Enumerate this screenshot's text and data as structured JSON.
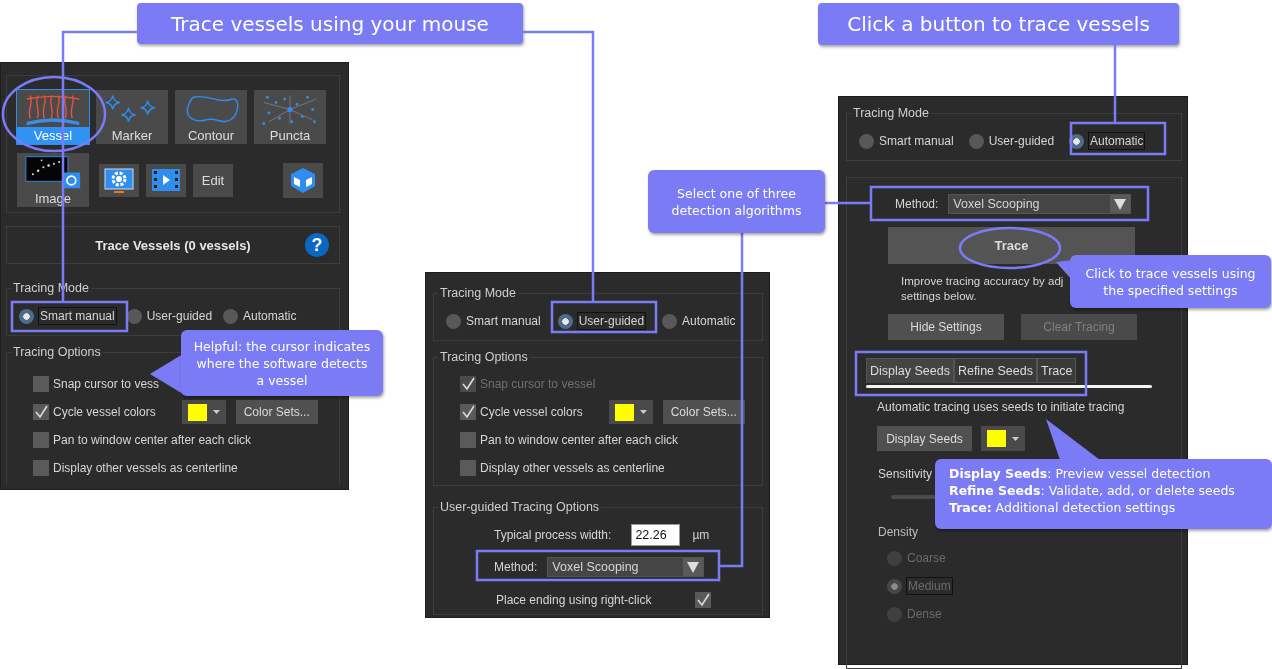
{
  "headings": [
    {
      "text": "Trace vessels using your mouse"
    },
    {
      "text": "Click a button to trace vessels"
    }
  ],
  "notes": [
    {
      "text": "Helpful: the cursor indicates where the software detects a vessel"
    },
    {
      "text": "Select one of three detection algorithms"
    },
    {
      "text": "Click to trace vessels using the specified settings"
    },
    {
      "lines": [
        "**Display Seeds**: Preview vessel detection",
        "**Refine Seeds**: Validate, add, or delete seeds",
        "**Trace:** Additional detection settings"
      ]
    }
  ],
  "smart_manual_panel": {
    "tools": [
      {
        "label": "Vessel",
        "selected": true
      },
      {
        "label": "Marker",
        "selected": false
      },
      {
        "label": "Contour",
        "selected": false
      },
      {
        "label": "Puncta",
        "selected": false
      }
    ],
    "image_tool": {
      "label": "Image"
    },
    "edit_button": "Edit",
    "title": "Trace Vessels (0 vessels)",
    "help": "?",
    "tracing_mode": {
      "legend": "Tracing Mode",
      "options": [
        {
          "label": "Smart manual",
          "selected": true
        },
        {
          "label": "User-guided",
          "selected": false
        },
        {
          "label": "Automatic",
          "selected": false
        }
      ]
    },
    "tracing_options": {
      "legend": "Tracing Options",
      "items": [
        {
          "label": "Snap cursor to vess",
          "checked": false,
          "disabled": false
        },
        {
          "label": "Cycle vessel colors",
          "checked": true,
          "disabled": false,
          "color": "#ffff00",
          "button": "Color Sets..."
        },
        {
          "label": "Pan to window center after each click",
          "checked": false,
          "disabled": false
        },
        {
          "label": "Display other vessels as centerline",
          "checked": false,
          "disabled": false
        }
      ]
    }
  },
  "user_guided_panel": {
    "tracing_mode": {
      "legend": "Tracing Mode",
      "options": [
        {
          "label": "Smart manual",
          "selected": false
        },
        {
          "label": "User-guided",
          "selected": true
        },
        {
          "label": "Automatic",
          "selected": false
        }
      ]
    },
    "tracing_options": {
      "legend": "Tracing Options",
      "items": [
        {
          "label": "Snap cursor to vessel",
          "checked": true,
          "disabled": true
        },
        {
          "label": "Cycle vessel colors",
          "checked": true,
          "disabled": false,
          "color": "#ffff00",
          "button": "Color Sets..."
        },
        {
          "label": "Pan to window center after each click",
          "checked": false,
          "disabled": false
        },
        {
          "label": "Display other vessels as centerline",
          "checked": false,
          "disabled": false
        }
      ]
    },
    "user_guided_options": {
      "legend": "User-guided Tracing Options",
      "width_label": "Typical process width:",
      "width_value": "22.26",
      "width_unit": "µm",
      "method_label": "Method:",
      "method_value": "Voxel Scooping",
      "right_click_label": "Place ending using right-click",
      "right_click_checked": true
    }
  },
  "automatic_panel": {
    "tracing_mode": {
      "legend": "Tracing Mode",
      "options": [
        {
          "label": "Smart manual",
          "selected": false
        },
        {
          "label": "User-guided",
          "selected": false
        },
        {
          "label": "Automatic",
          "selected": true
        }
      ]
    },
    "method_label": "Method:",
    "method_value": "Voxel Scooping",
    "trace_button": "Trace",
    "hint_lines": [
      "Improve tracing accuracy by adj",
      "settings below."
    ],
    "hide_button": "Hide Settings",
    "clear_button": {
      "label": "Clear Tracing",
      "disabled": true
    },
    "tabs": [
      {
        "label": "Display Seeds",
        "selected": true
      },
      {
        "label": "Refine Seeds",
        "selected": false
      },
      {
        "label": "Trace",
        "selected": false
      }
    ],
    "description": "Automatic tracing uses seeds to initiate tracing",
    "seeds_button": "Display Seeds",
    "seeds_swatch": {
      "color": "#ffff00"
    },
    "sensitivity_label": "Sensitivity",
    "density": {
      "legend": "Density",
      "disabled": true,
      "options": [
        {
          "label": "Coarse",
          "selected": false
        },
        {
          "label": "Medium",
          "selected": true
        },
        {
          "label": "Dense",
          "selected": false
        }
      ]
    }
  }
}
